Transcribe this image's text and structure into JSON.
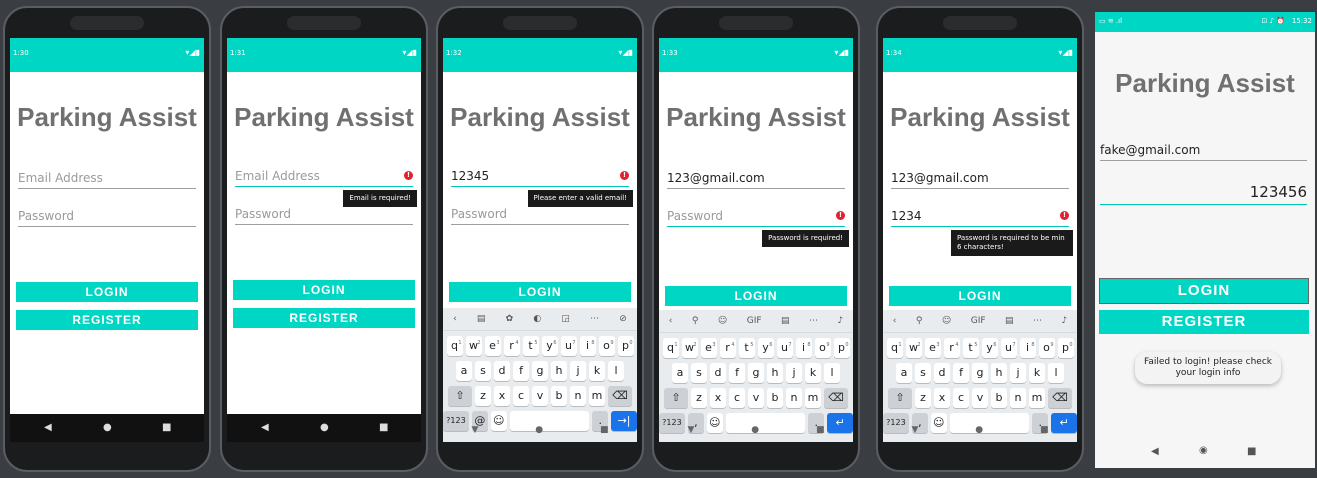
{
  "app_title": "Parking Assist",
  "buttons": {
    "login": "LOGIN",
    "register": "REGISTER"
  },
  "placeholders": {
    "email": "Email Address",
    "password": "Password"
  },
  "phones": [
    {
      "time": "1:30",
      "email": "",
      "password": "",
      "tip": ""
    },
    {
      "time": "1:31",
      "email": "",
      "password": "",
      "tip": "Email is required!"
    },
    {
      "time": "1:32",
      "email": "12345",
      "password": "",
      "tip": "Please enter a valid email!"
    },
    {
      "time": "1:33",
      "email": "123@gmail.com",
      "password": "",
      "tip": "Password is required!"
    },
    {
      "time": "1:34",
      "email": "123@gmail.com",
      "password": "1234",
      "tip": "Password is required to be min 6 characters!"
    },
    {
      "time": "15:32",
      "email": "fake@gmail.com",
      "password": "123456",
      "tip": ""
    }
  ],
  "toast": "Failed to login! please check your login info",
  "keyboard": {
    "row1": [
      "q",
      "w",
      "e",
      "r",
      "t",
      "y",
      "u",
      "i",
      "o",
      "p"
    ],
    "row1_nums": [
      "1",
      "2",
      "3",
      "4",
      "5",
      "6",
      "7",
      "8",
      "9",
      "0"
    ],
    "row2": [
      "a",
      "s",
      "d",
      "f",
      "g",
      "h",
      "j",
      "k",
      "l"
    ],
    "row3": [
      "z",
      "x",
      "c",
      "v",
      "b",
      "n",
      "m"
    ],
    "sym": "?123",
    "gif": "GIF"
  },
  "colors": {
    "accent": "#00d6c4",
    "error": "#e3202c",
    "title": "#707070"
  }
}
